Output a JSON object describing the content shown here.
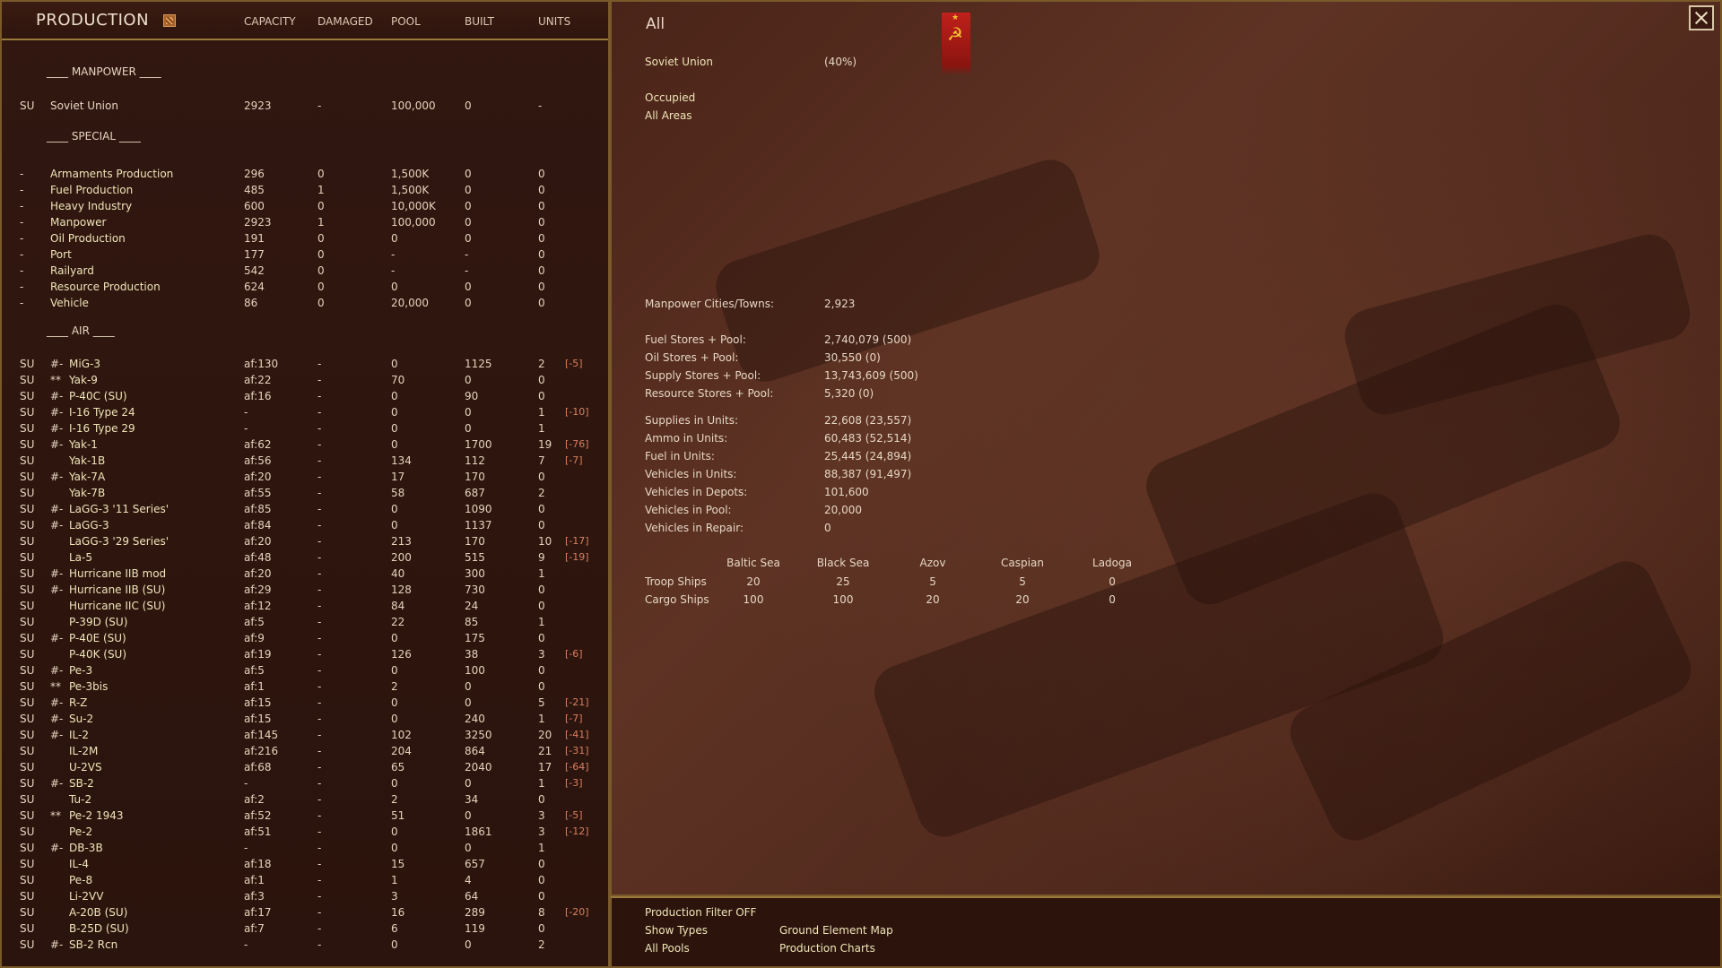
{
  "header": {
    "title": "PRODUCTION",
    "columns": [
      "CAPACITY",
      "DAMAGED",
      "POOL",
      "BUILT",
      "UNITS"
    ]
  },
  "sections": {
    "manpower": "____ MANPOWER ____",
    "special": "____ SPECIAL ____",
    "air": "____  AIR  ____"
  },
  "manpower_row": {
    "nat": "SU",
    "name": "Soviet Union",
    "cap": "2923",
    "dmg": "-",
    "pool": "100,000",
    "built": "0",
    "units": "-"
  },
  "special_rows": [
    {
      "nat": "-",
      "name": "Armaments Production",
      "cap": "296",
      "dmg": "0",
      "pool": "1,500K",
      "built": "0",
      "units": "0"
    },
    {
      "nat": "-",
      "name": "Fuel Production",
      "cap": "485",
      "dmg": "1",
      "pool": "1,500K",
      "built": "0",
      "units": "0"
    },
    {
      "nat": "-",
      "name": "Heavy Industry",
      "cap": "600",
      "dmg": "0",
      "pool": "10,000K",
      "built": "0",
      "units": "0"
    },
    {
      "nat": "-",
      "name": "Manpower",
      "cap": "2923",
      "dmg": "1",
      "pool": "100,000",
      "built": "0",
      "units": "0"
    },
    {
      "nat": "-",
      "name": "Oil Production",
      "cap": "191",
      "dmg": "0",
      "pool": "0",
      "built": "0",
      "units": "0"
    },
    {
      "nat": "-",
      "name": "Port",
      "cap": "177",
      "dmg": "0",
      "pool": "-",
      "built": "-",
      "units": "0"
    },
    {
      "nat": "-",
      "name": "Railyard",
      "cap": "542",
      "dmg": "0",
      "pool": "-",
      "built": "-",
      "units": "0"
    },
    {
      "nat": "-",
      "name": "Resource Production",
      "cap": "624",
      "dmg": "0",
      "pool": "0",
      "built": "0",
      "units": "0"
    },
    {
      "nat": "-",
      "name": "Vehicle",
      "cap": "86",
      "dmg": "0",
      "pool": "20,000",
      "built": "0",
      "units": "0"
    }
  ],
  "air_rows": [
    {
      "nat": "SU",
      "mark": "#-",
      "name": "MiG-3",
      "cap": "af:130",
      "dmg": "-",
      "pool": "0",
      "built": "1125",
      "units": "2",
      "extra": "[-5]"
    },
    {
      "nat": "SU",
      "mark": "**",
      "name": "Yak-9",
      "cap": "af:22",
      "dmg": "-",
      "pool": "70",
      "built": "0",
      "units": "0",
      "extra": ""
    },
    {
      "nat": "SU",
      "mark": "#-",
      "name": "P-40C (SU)",
      "cap": "af:16",
      "dmg": "-",
      "pool": "0",
      "built": "90",
      "units": "0",
      "extra": ""
    },
    {
      "nat": "SU",
      "mark": "#-",
      "name": "I-16 Type 24",
      "cap": "-",
      "dmg": "-",
      "pool": "0",
      "built": "0",
      "units": "1",
      "extra": "[-10]"
    },
    {
      "nat": "SU",
      "mark": "#-",
      "name": "I-16 Type 29",
      "cap": "-",
      "dmg": "-",
      "pool": "0",
      "built": "0",
      "units": "1",
      "extra": ""
    },
    {
      "nat": "SU",
      "mark": "#-",
      "name": "Yak-1",
      "cap": "af:62",
      "dmg": "-",
      "pool": "0",
      "built": "1700",
      "units": "19",
      "extra": "[-76]"
    },
    {
      "nat": "SU",
      "mark": "",
      "name": "Yak-1B",
      "cap": "af:56",
      "dmg": "-",
      "pool": "134",
      "built": "112",
      "units": "7",
      "extra": "[-7]"
    },
    {
      "nat": "SU",
      "mark": "#-",
      "name": "Yak-7A",
      "cap": "af:20",
      "dmg": "-",
      "pool": "17",
      "built": "170",
      "units": "0",
      "extra": ""
    },
    {
      "nat": "SU",
      "mark": "",
      "name": "Yak-7B",
      "cap": "af:55",
      "dmg": "-",
      "pool": "58",
      "built": "687",
      "units": "2",
      "extra": ""
    },
    {
      "nat": "SU",
      "mark": "#-",
      "name": "LaGG-3 '11 Series'",
      "cap": "af:85",
      "dmg": "-",
      "pool": "0",
      "built": "1090",
      "units": "0",
      "extra": ""
    },
    {
      "nat": "SU",
      "mark": "#-",
      "name": "LaGG-3",
      "cap": "af:84",
      "dmg": "-",
      "pool": "0",
      "built": "1137",
      "units": "0",
      "extra": ""
    },
    {
      "nat": "SU",
      "mark": "",
      "name": "LaGG-3 '29 Series'",
      "cap": "af:20",
      "dmg": "-",
      "pool": "213",
      "built": "170",
      "units": "10",
      "extra": "[-17]"
    },
    {
      "nat": "SU",
      "mark": "",
      "name": "La-5",
      "cap": "af:48",
      "dmg": "-",
      "pool": "200",
      "built": "515",
      "units": "9",
      "extra": "[-19]"
    },
    {
      "nat": "SU",
      "mark": "#-",
      "name": "Hurricane IIB mod",
      "cap": "af:20",
      "dmg": "-",
      "pool": "40",
      "built": "300",
      "units": "1",
      "extra": ""
    },
    {
      "nat": "SU",
      "mark": "#-",
      "name": "Hurricane IIB (SU)",
      "cap": "af:29",
      "dmg": "-",
      "pool": "128",
      "built": "730",
      "units": "0",
      "extra": ""
    },
    {
      "nat": "SU",
      "mark": "",
      "name": "Hurricane IIC (SU)",
      "cap": "af:12",
      "dmg": "-",
      "pool": "84",
      "built": "24",
      "units": "0",
      "extra": ""
    },
    {
      "nat": "SU",
      "mark": "",
      "name": "P-39D (SU)",
      "cap": "af:5",
      "dmg": "-",
      "pool": "22",
      "built": "85",
      "units": "1",
      "extra": ""
    },
    {
      "nat": "SU",
      "mark": "#-",
      "name": "P-40E (SU)",
      "cap": "af:9",
      "dmg": "-",
      "pool": "0",
      "built": "175",
      "units": "0",
      "extra": ""
    },
    {
      "nat": "SU",
      "mark": "",
      "name": "P-40K (SU)",
      "cap": "af:19",
      "dmg": "-",
      "pool": "126",
      "built": "38",
      "units": "3",
      "extra": "[-6]"
    },
    {
      "nat": "SU",
      "mark": "#-",
      "name": "Pe-3",
      "cap": "af:5",
      "dmg": "-",
      "pool": "0",
      "built": "100",
      "units": "0",
      "extra": ""
    },
    {
      "nat": "SU",
      "mark": "**",
      "name": "Pe-3bis",
      "cap": "af:1",
      "dmg": "-",
      "pool": "2",
      "built": "0",
      "units": "0",
      "extra": ""
    },
    {
      "nat": "SU",
      "mark": "#-",
      "name": "R-Z",
      "cap": "af:15",
      "dmg": "-",
      "pool": "0",
      "built": "0",
      "units": "5",
      "extra": "[-21]"
    },
    {
      "nat": "SU",
      "mark": "#-",
      "name": "Su-2",
      "cap": "af:15",
      "dmg": "-",
      "pool": "0",
      "built": "240",
      "units": "1",
      "extra": "[-7]"
    },
    {
      "nat": "SU",
      "mark": "#-",
      "name": "IL-2",
      "cap": "af:145",
      "dmg": "-",
      "pool": "102",
      "built": "3250",
      "units": "20",
      "extra": "[-41]"
    },
    {
      "nat": "SU",
      "mark": "",
      "name": "IL-2M",
      "cap": "af:216",
      "dmg": "-",
      "pool": "204",
      "built": "864",
      "units": "21",
      "extra": "[-31]"
    },
    {
      "nat": "SU",
      "mark": "",
      "name": "U-2VS",
      "cap": "af:68",
      "dmg": "-",
      "pool": "65",
      "built": "2040",
      "units": "17",
      "extra": "[-64]"
    },
    {
      "nat": "SU",
      "mark": "#-",
      "name": "SB-2",
      "cap": "-",
      "dmg": "-",
      "pool": "0",
      "built": "0",
      "units": "1",
      "extra": "[-3]"
    },
    {
      "nat": "SU",
      "mark": "",
      "name": "Tu-2",
      "cap": "af:2",
      "dmg": "-",
      "pool": "2",
      "built": "34",
      "units": "0",
      "extra": ""
    },
    {
      "nat": "SU",
      "mark": "**",
      "name": "Pe-2 1943",
      "cap": "af:52",
      "dmg": "-",
      "pool": "51",
      "built": "0",
      "units": "3",
      "extra": "[-5]"
    },
    {
      "nat": "SU",
      "mark": "",
      "name": "Pe-2",
      "cap": "af:51",
      "dmg": "-",
      "pool": "0",
      "built": "1861",
      "units": "3",
      "extra": "[-12]"
    },
    {
      "nat": "SU",
      "mark": "#-",
      "name": "DB-3B",
      "cap": "-",
      "dmg": "-",
      "pool": "0",
      "built": "0",
      "units": "1",
      "extra": ""
    },
    {
      "nat": "SU",
      "mark": "",
      "name": "IL-4",
      "cap": "af:18",
      "dmg": "-",
      "pool": "15",
      "built": "657",
      "units": "0",
      "extra": ""
    },
    {
      "nat": "SU",
      "mark": "",
      "name": "Pe-8",
      "cap": "af:1",
      "dmg": "-",
      "pool": "1",
      "built": "4",
      "units": "0",
      "extra": ""
    },
    {
      "nat": "SU",
      "mark": "",
      "name": "Li-2VV",
      "cap": "af:3",
      "dmg": "-",
      "pool": "3",
      "built": "64",
      "units": "0",
      "extra": ""
    },
    {
      "nat": "SU",
      "mark": "",
      "name": "A-20B (SU)",
      "cap": "af:17",
      "dmg": "-",
      "pool": "16",
      "built": "289",
      "units": "8",
      "extra": "[-20]"
    },
    {
      "nat": "SU",
      "mark": "",
      "name": "B-25D (SU)",
      "cap": "af:7",
      "dmg": "-",
      "pool": "6",
      "built": "119",
      "units": "0",
      "extra": ""
    },
    {
      "nat": "SU",
      "mark": "#-",
      "name": "SB-2 Rcn",
      "cap": "-",
      "dmg": "-",
      "pool": "0",
      "built": "0",
      "units": "2",
      "extra": ""
    }
  ],
  "right": {
    "title": "All",
    "nation": "Soviet Union",
    "nation_pct": "(40%)",
    "occupied": "Occupied",
    "all_areas": "All Areas",
    "stats1": [
      {
        "label": "Manpower Cities/Towns:",
        "value": "2,923"
      }
    ],
    "stats2": [
      {
        "label": "Fuel Stores + Pool:",
        "value": "2,740,079 (500)"
      },
      {
        "label": "Oil Stores + Pool:",
        "value": "30,550 (0)"
      },
      {
        "label": "Supply Stores + Pool:",
        "value": "13,743,609 (500)"
      },
      {
        "label": "Resource Stores + Pool:",
        "value": "5,320 (0)"
      }
    ],
    "stats3": [
      {
        "label": "Supplies in Units:",
        "value": "22,608 (23,557)"
      },
      {
        "label": "Ammo in Units:",
        "value": "60,483 (52,514)"
      },
      {
        "label": "Fuel in Units:",
        "value": "25,445 (24,894)"
      },
      {
        "label": "Vehicles in Units:",
        "value": "88,387 (91,497)"
      },
      {
        "label": "Vehicles in Depots:",
        "value": "101,600"
      },
      {
        "label": "Vehicles in Pool:",
        "value": "20,000"
      },
      {
        "label": "Vehicles in Repair:",
        "value": "0"
      }
    ],
    "ships": {
      "seas": [
        "Baltic Sea",
        "Black Sea",
        "Azov",
        "Caspian",
        "Ladoga"
      ],
      "rows": [
        {
          "label": "Troop Ships",
          "values": [
            "20",
            "25",
            "5",
            "5",
            "0"
          ]
        },
        {
          "label": "Cargo Ships",
          "values": [
            "100",
            "100",
            "20",
            "20",
            "0"
          ]
        }
      ]
    }
  },
  "bottom": {
    "production_filter": "Production Filter OFF",
    "show_types": "Show Types",
    "all_pools": "All Pools",
    "ground_element_map": "Ground Element Map",
    "production_charts": "Production Charts"
  },
  "icons": {
    "close": "close-icon",
    "flag": "soviet-flag-icon",
    "filter": "filter-icon"
  },
  "colors": {
    "accent": "#9a7a3a",
    "link_yellow": "#f0e4b8",
    "flag_red": "#c0201a",
    "penalty": "#d88060"
  }
}
